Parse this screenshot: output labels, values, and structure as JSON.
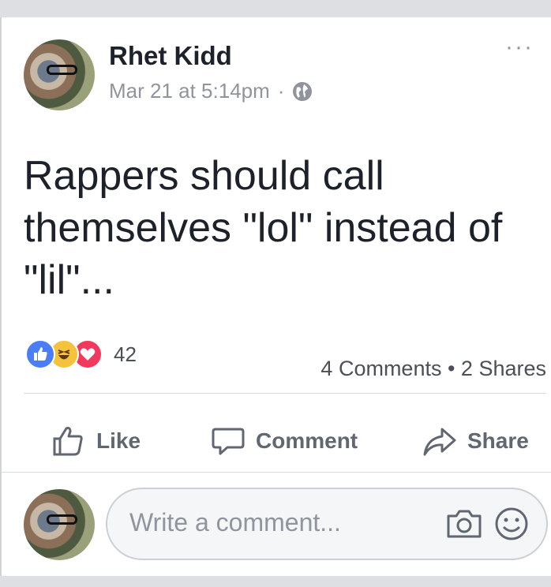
{
  "post": {
    "author": "Rhet Kidd",
    "timestamp": "Mar 21 at 5:14pm",
    "separator": "·",
    "privacy_icon": "globe-icon",
    "more_label": "···",
    "text": "Rappers should call themselves \"lol\" instead of \"lil\"..."
  },
  "reactions": {
    "types": [
      "like",
      "haha",
      "love"
    ],
    "count": "42"
  },
  "stats": {
    "text": "4 Comments • 2 Shares"
  },
  "actions": {
    "like_label": "Like",
    "comment_label": "Comment",
    "share_label": "Share"
  },
  "comment_box": {
    "placeholder": "Write a comment..."
  },
  "colors": {
    "like_blue": "#4a7df6",
    "haha_yellow": "#f5c33b",
    "love_red": "#f0395c",
    "secondary_text": "#90949c"
  }
}
